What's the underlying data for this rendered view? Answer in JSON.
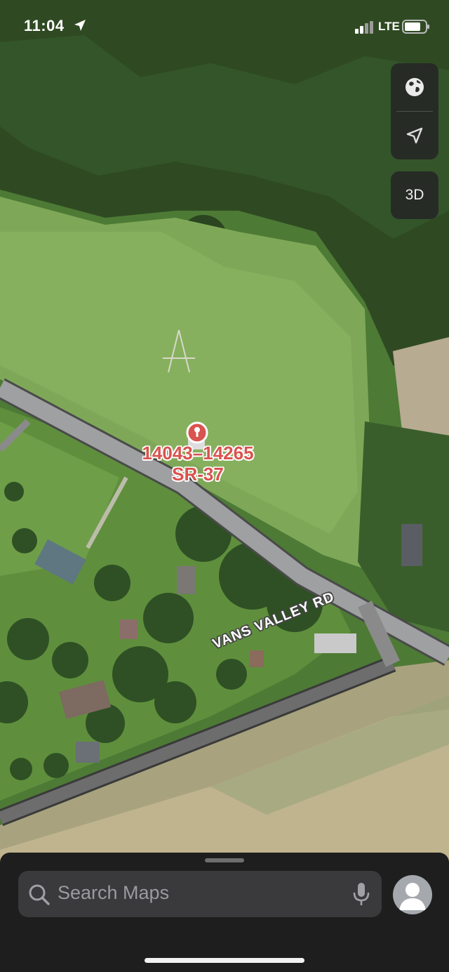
{
  "status_bar": {
    "time": "11:04",
    "network": "LTE"
  },
  "map_controls": {
    "three_d_label": "3D"
  },
  "pin": {
    "address_line1": "14043–14265",
    "address_line2": "SR-37",
    "color": "#d9534f"
  },
  "road": {
    "name": "VANS VALLEY RD"
  },
  "search": {
    "placeholder": "Search Maps"
  },
  "icons": [
    "location-arrow-icon",
    "signal-icon",
    "battery-icon",
    "globe-icon",
    "navigate-icon",
    "pin-icon",
    "search-icon",
    "mic-icon",
    "avatar-icon"
  ]
}
